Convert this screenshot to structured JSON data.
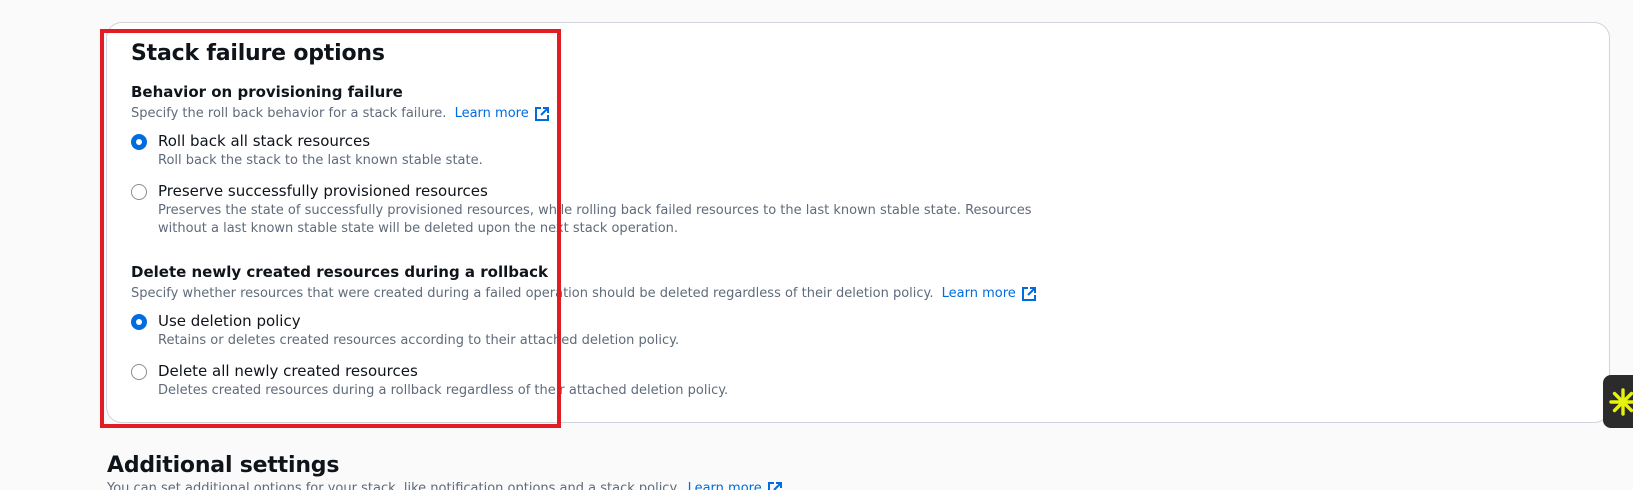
{
  "stack_failure": {
    "title": "Stack failure options",
    "behavior": {
      "label": "Behavior on provisioning failure",
      "description": "Specify the roll back behavior for a stack failure.",
      "learn_more": "Learn more",
      "options": [
        {
          "label": "Roll back all stack resources",
          "description": "Roll back the stack to the last known stable state.",
          "checked": true
        },
        {
          "label": "Preserve successfully provisioned resources",
          "description": "Preserves the state of successfully provisioned resources, while rolling back failed resources to the last known stable state. Resources without a last known stable state will be deleted upon the next stack operation.",
          "checked": false
        }
      ]
    },
    "delete_new": {
      "label": "Delete newly created resources during a rollback",
      "description": "Specify whether resources that were created during a failed operation should be deleted regardless of their deletion policy.",
      "learn_more": "Learn more",
      "options": [
        {
          "label": "Use deletion policy",
          "description": "Retains or deletes created resources according to their attached deletion policy.",
          "checked": true
        },
        {
          "label": "Delete all newly created resources",
          "description": "Deletes created resources during a rollback regardless of their attached deletion policy.",
          "checked": false
        }
      ]
    }
  },
  "additional_settings": {
    "title": "Additional settings",
    "description": "You can set additional options for your stack, like notification options and a stack policy.",
    "learn_more": "Learn more"
  },
  "icons": {
    "external_link": "external-link-icon",
    "side_widget": "sparkle-icon"
  },
  "colors": {
    "accent": "#006ce0",
    "highlight": "#e31b23",
    "side_widget_icon": "#e6f20a"
  }
}
